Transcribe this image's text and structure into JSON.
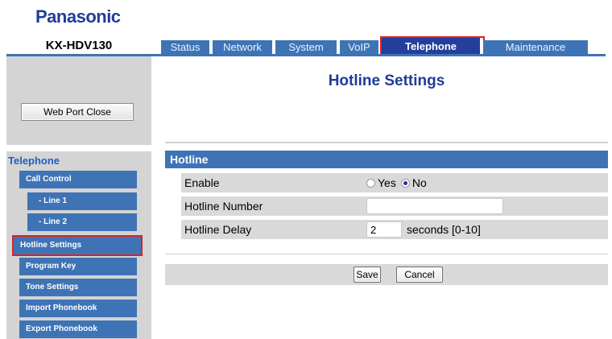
{
  "brand": "Panasonic",
  "model": "KX-HDV130",
  "tabs": [
    {
      "label": "Status"
    },
    {
      "label": "Network"
    },
    {
      "label": "System"
    },
    {
      "label": "VoIP"
    },
    {
      "label": "Telephone",
      "active": true
    },
    {
      "label": "Maintenance"
    }
  ],
  "sidebar": {
    "web_port_close": "Web Port Close",
    "heading": "Telephone",
    "items": [
      {
        "label": "Call Control"
      },
      {
        "label": "- Line 1"
      },
      {
        "label": "- Line 2"
      },
      {
        "label": "Hotline Settings",
        "active": true
      },
      {
        "label": "Program Key"
      },
      {
        "label": "Tone Settings"
      },
      {
        "label": "Import Phonebook"
      },
      {
        "label": "Export Phonebook"
      }
    ]
  },
  "page": {
    "title": "Hotline Settings",
    "section": "Hotline",
    "fields": {
      "enable_label": "Enable",
      "enable_options": [
        "Yes",
        "No"
      ],
      "enable_selected": "No",
      "number_label": "Hotline Number",
      "number_value": "",
      "delay_label": "Hotline Delay",
      "delay_value": "2",
      "delay_suffix": "seconds [0-10]"
    },
    "buttons": {
      "save": "Save",
      "cancel": "Cancel"
    }
  },
  "colors": {
    "tab_blue": "#3e74b5",
    "active_tab": "#243f9b",
    "highlight_red": "#e02020",
    "title_blue": "#1f3c99"
  }
}
